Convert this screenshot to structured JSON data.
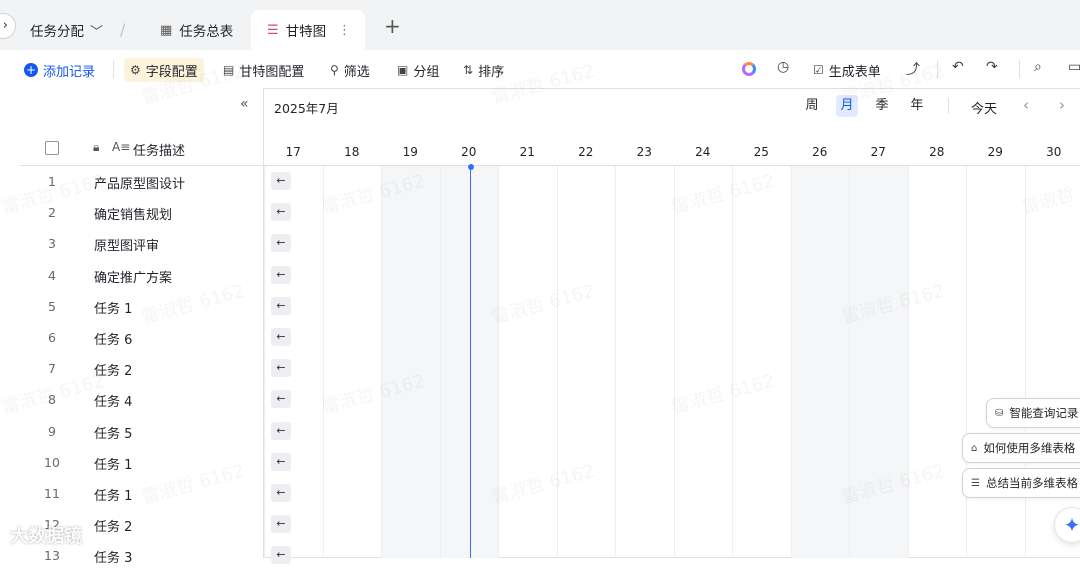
{
  "tabs": {
    "view_switch": "任务分配",
    "items": [
      {
        "label": "任务总表",
        "icon": "grid-icon"
      },
      {
        "label": "甘特图",
        "icon": "gantt-icon"
      }
    ]
  },
  "toolbar": {
    "add_record": "添加记录",
    "field_config": "字段配置",
    "gantt_config": "甘特图配置",
    "filter": "筛选",
    "group": "分组",
    "sort": "排序",
    "generate_form": "生成表单"
  },
  "grid": {
    "header_title": "任务描述",
    "rows": [
      {
        "num": "1",
        "desc": "产品原型图设计"
      },
      {
        "num": "2",
        "desc": "确定销售规划"
      },
      {
        "num": "3",
        "desc": "原型图评审"
      },
      {
        "num": "4",
        "desc": "确定推广方案"
      },
      {
        "num": "5",
        "desc": "任务 1"
      },
      {
        "num": "6",
        "desc": "任务 6"
      },
      {
        "num": "7",
        "desc": "任务 2"
      },
      {
        "num": "8",
        "desc": "任务 4"
      },
      {
        "num": "9",
        "desc": "任务 5"
      },
      {
        "num": "10",
        "desc": "任务 1"
      },
      {
        "num": "11",
        "desc": "任务 1"
      },
      {
        "num": "12",
        "desc": "任务 2"
      },
      {
        "num": "13",
        "desc": "任务 3"
      }
    ]
  },
  "timeline": {
    "month": "2025年7月",
    "scales": [
      "周",
      "月",
      "季",
      "年"
    ],
    "active_scale": "月",
    "today": "今天",
    "days": [
      "17",
      "18",
      "19",
      "20",
      "21",
      "22",
      "23",
      "24",
      "25",
      "26",
      "27",
      "28",
      "29",
      "30"
    ],
    "weekend_days": [
      "19",
      "20",
      "26",
      "27"
    ],
    "today_day": "20"
  },
  "suggestions": [
    "智能查询记录",
    "如何使用多维表格",
    "总结当前多维表格"
  ],
  "watermark": "雷淑哲 6162",
  "corner_watermark": "大数据镜",
  "colors": {
    "accent": "#1456f0",
    "today_line": "#3370ff"
  }
}
